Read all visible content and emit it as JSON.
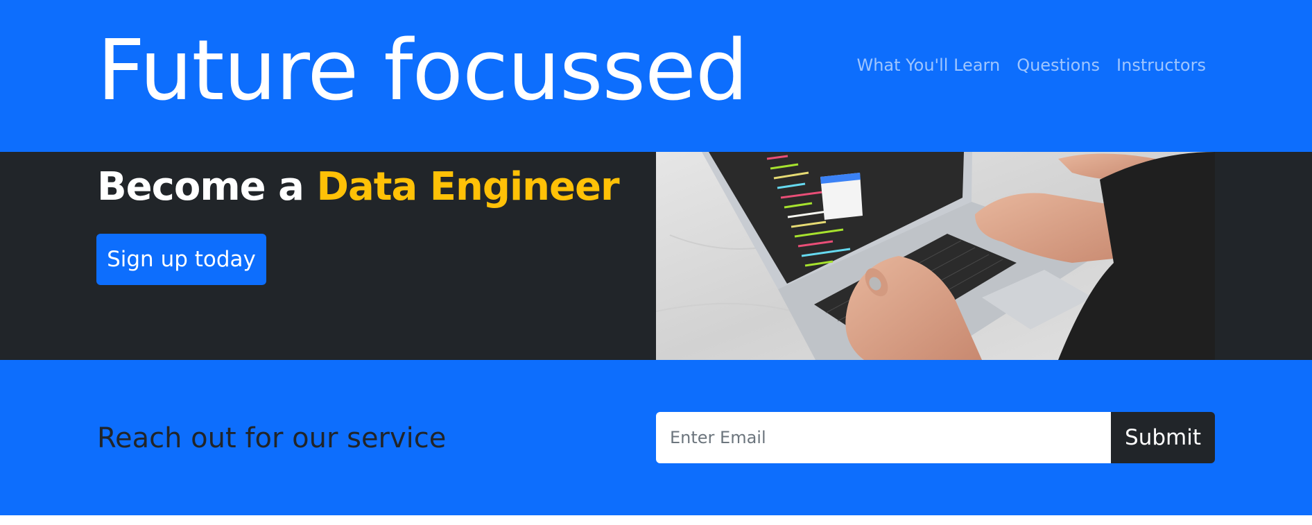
{
  "navbar": {
    "brand": "Future focussed",
    "links": [
      "What You'll Learn",
      "Questions",
      "Instructors"
    ]
  },
  "hero": {
    "title_prefix": "Become a ",
    "title_highlight": "Data Engineer",
    "cta_label": "Sign up today",
    "image_description": "laptop-coding-photo"
  },
  "newsletter": {
    "title": "Reach out for our service",
    "email_placeholder": "Enter Email",
    "submit_label": "Submit"
  },
  "colors": {
    "primary": "#0d6efd",
    "dark": "#212529",
    "warning": "#ffc107"
  }
}
